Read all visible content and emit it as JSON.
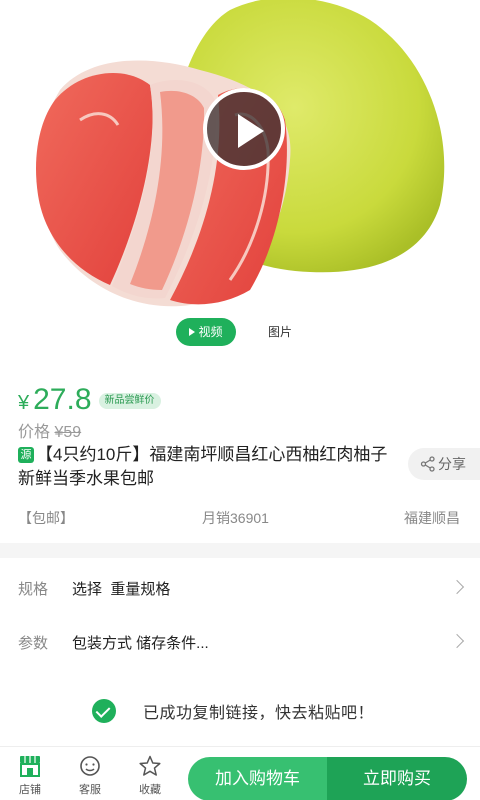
{
  "media": {
    "tab_video": "视频",
    "tab_photo": "图片"
  },
  "price": {
    "currency": "¥",
    "current": "27.8",
    "badge": "新品尝鲜价",
    "original_label": "价格",
    "original": "¥59"
  },
  "product": {
    "source_badge": "源",
    "title": "【4只约10斤】福建南坪顺昌红心西柚红肉柚子新鲜当季水果包邮"
  },
  "share": {
    "label": "分享"
  },
  "meta": {
    "shipping": "【包邮】",
    "monthly_sales": "月销36901",
    "origin": "福建顺昌"
  },
  "specs": [
    {
      "label": "规格",
      "value": "选择  重量规格"
    },
    {
      "label": "参数",
      "value": "包装方式 储存条件..."
    }
  ],
  "toast": {
    "message": "已成功复制链接，快去粘贴吧！"
  },
  "bottom_nav": {
    "store": "店铺",
    "service": "客服",
    "favorite": "收藏",
    "add_to_cart": "加入购物车",
    "buy_now": "立即购买"
  },
  "colors": {
    "brand_green": "#1fb05b",
    "cart_green": "#37c071",
    "buy_green": "#1ea356",
    "price_green": "#2dac5a"
  }
}
